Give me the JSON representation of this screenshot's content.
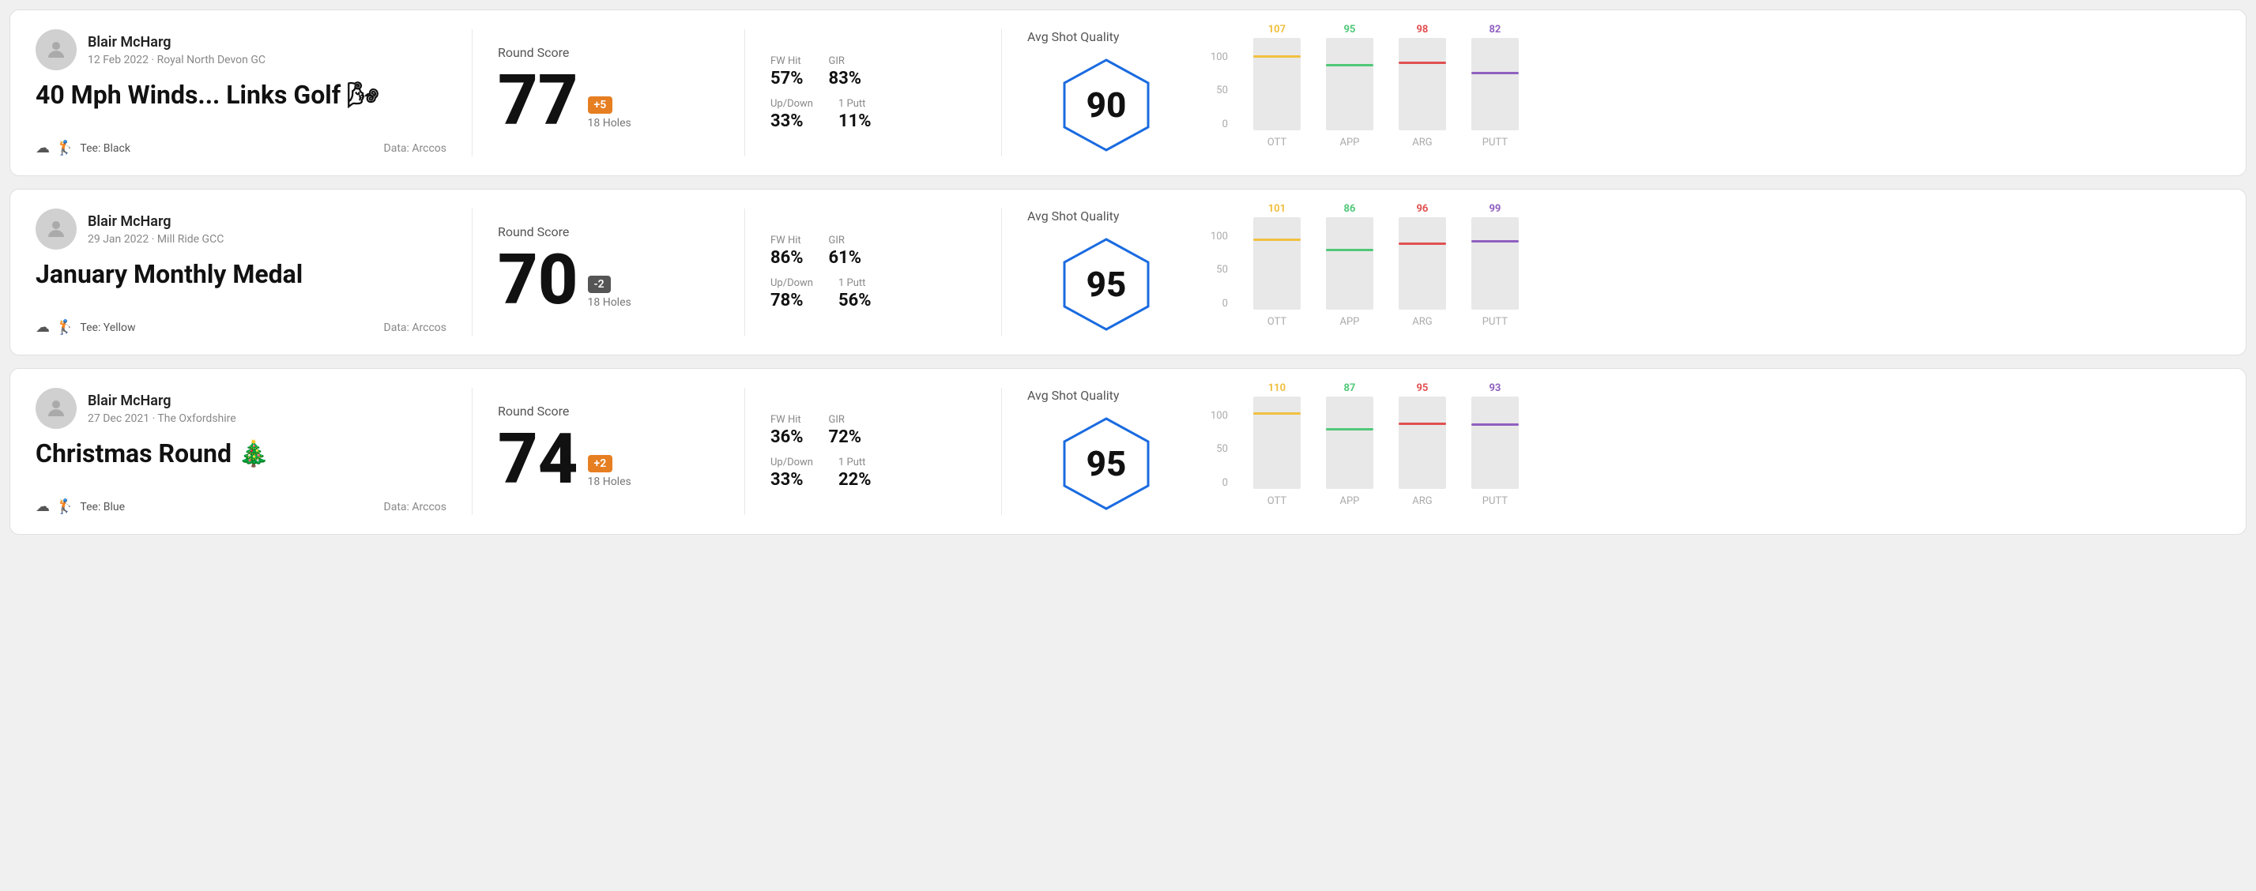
{
  "rounds": [
    {
      "id": "round-1",
      "user": {
        "name": "Blair McHarg",
        "date": "12 Feb 2022 · Royal North Devon GC"
      },
      "title": "40 Mph Winds... Links Golf 🌬",
      "tee": "Tee: Black",
      "data_source": "Data: Arccos",
      "score": {
        "value": "77",
        "differential": "+5",
        "differential_type": "pos",
        "holes": "18 Holes"
      },
      "stats": {
        "fw_hit_label": "FW Hit",
        "fw_hit_value": "57%",
        "gir_label": "GIR",
        "gir_value": "83%",
        "updown_label": "Up/Down",
        "updown_value": "33%",
        "putt_label": "1 Putt",
        "putt_value": "11%"
      },
      "quality": {
        "label": "Avg Shot Quality",
        "value": "90"
      },
      "chart": {
        "bars": [
          {
            "category": "OTT",
            "value": 107,
            "color_class": "color-ott",
            "line_class": "line-ott",
            "height_pct": 78
          },
          {
            "category": "APP",
            "value": 95,
            "color_class": "color-app",
            "line_class": "line-app",
            "height_pct": 69
          },
          {
            "category": "ARG",
            "value": 98,
            "color_class": "color-arg",
            "line_class": "line-arg",
            "height_pct": 71
          },
          {
            "category": "PUTT",
            "value": 82,
            "color_class": "color-putt",
            "line_class": "line-putt",
            "height_pct": 60
          }
        ],
        "y_labels": [
          "100",
          "50",
          "0"
        ]
      }
    },
    {
      "id": "round-2",
      "user": {
        "name": "Blair McHarg",
        "date": "29 Jan 2022 · Mill Ride GCC"
      },
      "title": "January Monthly Medal",
      "tee": "Tee: Yellow",
      "data_source": "Data: Arccos",
      "score": {
        "value": "70",
        "differential": "-2",
        "differential_type": "neg",
        "holes": "18 Holes"
      },
      "stats": {
        "fw_hit_label": "FW Hit",
        "fw_hit_value": "86%",
        "gir_label": "GIR",
        "gir_value": "61%",
        "updown_label": "Up/Down",
        "updown_value": "78%",
        "putt_label": "1 Putt",
        "putt_value": "56%"
      },
      "quality": {
        "label": "Avg Shot Quality",
        "value": "95"
      },
      "chart": {
        "bars": [
          {
            "category": "OTT",
            "value": 101,
            "color_class": "color-ott",
            "line_class": "line-ott",
            "height_pct": 74
          },
          {
            "category": "APP",
            "value": 86,
            "color_class": "color-app",
            "line_class": "line-app",
            "height_pct": 63
          },
          {
            "category": "ARG",
            "value": 96,
            "color_class": "color-arg",
            "line_class": "line-arg",
            "height_pct": 70
          },
          {
            "category": "PUTT",
            "value": 99,
            "color_class": "color-putt",
            "line_class": "line-putt",
            "height_pct": 72
          }
        ],
        "y_labels": [
          "100",
          "50",
          "0"
        ]
      }
    },
    {
      "id": "round-3",
      "user": {
        "name": "Blair McHarg",
        "date": "27 Dec 2021 · The Oxfordshire"
      },
      "title": "Christmas Round 🎄",
      "tee": "Tee: Blue",
      "data_source": "Data: Arccos",
      "score": {
        "value": "74",
        "differential": "+2",
        "differential_type": "pos",
        "holes": "18 Holes"
      },
      "stats": {
        "fw_hit_label": "FW Hit",
        "fw_hit_value": "36%",
        "gir_label": "GIR",
        "gir_value": "72%",
        "updown_label": "Up/Down",
        "updown_value": "33%",
        "putt_label": "1 Putt",
        "putt_value": "22%"
      },
      "quality": {
        "label": "Avg Shot Quality",
        "value": "95"
      },
      "chart": {
        "bars": [
          {
            "category": "OTT",
            "value": 110,
            "color_class": "color-ott",
            "line_class": "line-ott",
            "height_pct": 80
          },
          {
            "category": "APP",
            "value": 87,
            "color_class": "color-app",
            "line_class": "line-app",
            "height_pct": 63
          },
          {
            "category": "ARG",
            "value": 95,
            "color_class": "color-arg",
            "line_class": "line-arg",
            "height_pct": 69
          },
          {
            "category": "PUTT",
            "value": 93,
            "color_class": "color-putt",
            "line_class": "line-putt",
            "height_pct": 68
          }
        ],
        "y_labels": [
          "100",
          "50",
          "0"
        ]
      }
    }
  ]
}
